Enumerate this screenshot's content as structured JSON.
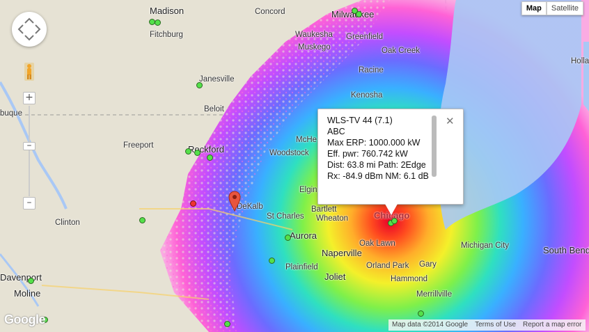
{
  "map": {
    "type_controls": {
      "map_label": "Map",
      "satellite_label": "Satellite",
      "active": "Map"
    },
    "attribution": {
      "data": "Map data ©2014 Google",
      "terms": "Terms of Use",
      "report": "Report a map error"
    },
    "logo_text": "Google",
    "marker_label": "DeKalb",
    "cities": [
      "Madison",
      "Concord",
      "Milwaukee",
      "Fitchburg",
      "Waukesha",
      "Greenfield",
      "Muskego",
      "Oak Creek",
      "Racine",
      "Janesville",
      "Kenosha",
      "Beloit",
      "buque",
      "Freeport",
      "Rockford",
      "Woodstock",
      "McHe",
      "Elgin",
      "DeKalb",
      "St Charles",
      "Bartlett",
      "Wheaton",
      "Chicago",
      "Aurora",
      "Naperville",
      "Oak Lawn",
      "Clinton",
      "Plainfield",
      "Joliet",
      "Orland Park",
      "Gary",
      "Hammond",
      "Michigan City",
      "South Bend",
      "Holla",
      "Davenport",
      "Moline",
      "Merrillville"
    ],
    "colors": {
      "water": "#a9c8f5",
      "land": "#e8e4d8",
      "chicago_label": "#b0303a",
      "station_green": "#55e04a",
      "station_red": "#ee3333"
    }
  },
  "infowindow": {
    "lines": [
      "WLS-TV 44 (7.1)",
      "ABC",
      "Max ERP: 1000.000 kW",
      "Eff. pwr: 760.742 kW",
      "Dist: 63.8 mi   Path: 2Edge",
      "Rx: -84.9 dBm   NM: 6.1 dB"
    ],
    "close_icon": "close-icon"
  }
}
